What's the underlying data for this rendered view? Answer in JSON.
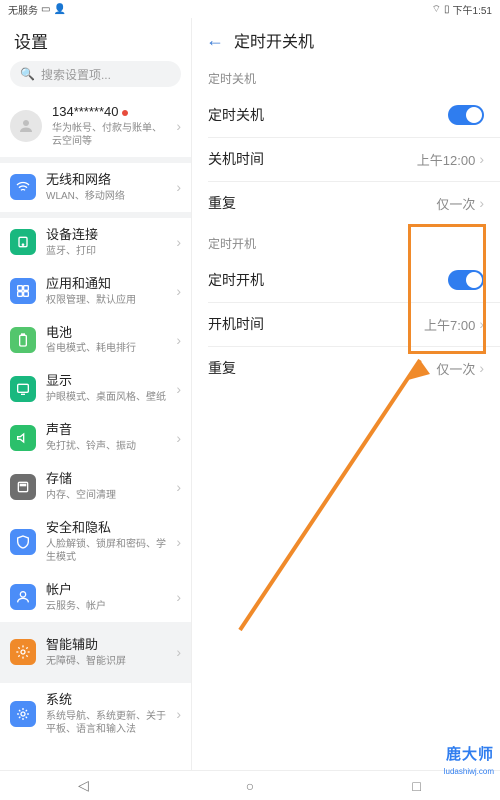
{
  "status": {
    "service_text": "无服务",
    "time_text": "下午1:51"
  },
  "left": {
    "title": "设置",
    "search_placeholder": "搜索设置项...",
    "account": {
      "title": "134******40",
      "sub": "华为帐号、付款与账单、云空间等"
    },
    "items": [
      {
        "icon_color": "#4b8df8",
        "icon": "wifi",
        "title": "无线和网络",
        "sub": "WLAN、移动网络"
      },
      {
        "icon_color": "#19b87f",
        "icon": "device",
        "title": "设备连接",
        "sub": "蓝牙、打印"
      },
      {
        "icon_color": "#4b8df8",
        "icon": "apps",
        "title": "应用和通知",
        "sub": "权限管理、默认应用"
      },
      {
        "icon_color": "#53c66d",
        "icon": "battery",
        "title": "电池",
        "sub": "省电模式、耗电排行"
      },
      {
        "icon_color": "#19b87f",
        "icon": "display",
        "title": "显示",
        "sub": "护眼模式、桌面风格、壁纸"
      },
      {
        "icon_color": "#2bc06b",
        "icon": "sound",
        "title": "声音",
        "sub": "免打扰、铃声、振动"
      },
      {
        "icon_color": "#6e6e6e",
        "icon": "storage",
        "title": "存储",
        "sub": "内存、空间清理"
      },
      {
        "icon_color": "#4b8df8",
        "icon": "security",
        "title": "安全和隐私",
        "sub": "人脸解锁、锁屏和密码、学生模式"
      },
      {
        "icon_color": "#4b8df8",
        "icon": "account",
        "title": "帐户",
        "sub": "云服务、帐户"
      },
      {
        "icon_color": "#f08a2a",
        "icon": "accessibility",
        "title": "智能辅助",
        "sub": "无障碍、智能识屏",
        "selected": true
      },
      {
        "icon_color": "#4b8df8",
        "icon": "system",
        "title": "系统",
        "sub": "系统导航、系统更新、关于平板、语言和输入法"
      }
    ]
  },
  "right": {
    "title": "定时开关机",
    "section1_head": "定时关机",
    "off_switch_label": "定时关机",
    "off_time_label": "关机时间",
    "off_time_value": "上午12:00",
    "off_repeat_label": "重复",
    "off_repeat_value": "仅一次",
    "section2_head": "定时开机",
    "on_switch_label": "定时开机",
    "on_time_label": "开机时间",
    "on_time_value": "上午7:00",
    "on_repeat_label": "重复",
    "on_repeat_value": "仅一次"
  },
  "annotation": {
    "highlight_color": "#f08a2a",
    "arrow_color": "#f08a2a"
  },
  "watermark": {
    "text": "鹿大师",
    "url": "ludashiwj.com"
  }
}
